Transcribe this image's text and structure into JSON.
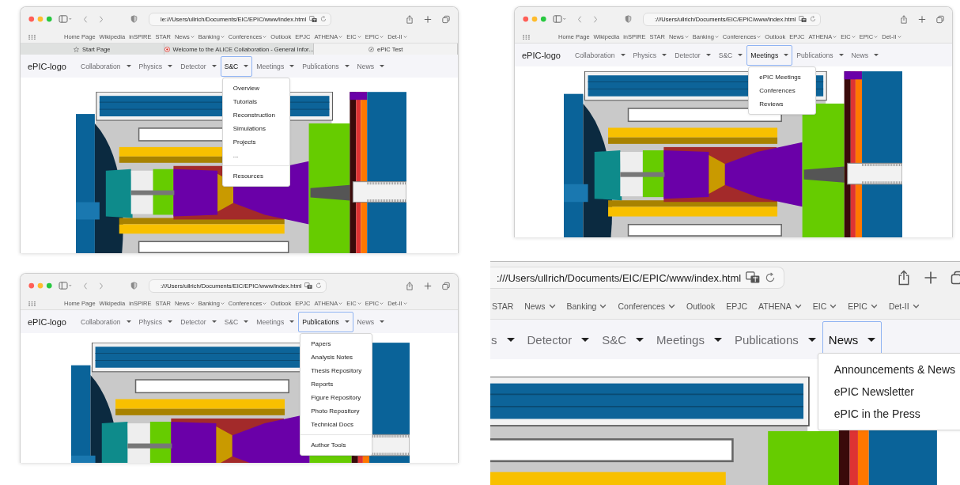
{
  "panels": [
    {
      "kind": "window",
      "address": "le:///Users/ullrich/Documents/EIC/EPIC/www/index.html",
      "bookmarks": [
        {
          "label": "Home Page",
          "menu": false
        },
        {
          "label": "Wikipedia",
          "menu": false
        },
        {
          "label": "inSPIRE",
          "menu": false
        },
        {
          "label": "STAR",
          "menu": false
        },
        {
          "label": "News",
          "menu": true
        },
        {
          "label": "Banking",
          "menu": true
        },
        {
          "label": "Conferences",
          "menu": true
        },
        {
          "label": "Outlook",
          "menu": false
        },
        {
          "label": "EPJC",
          "menu": false
        },
        {
          "label": "ATHENA",
          "menu": true
        },
        {
          "label": "EIC",
          "menu": true
        },
        {
          "label": "EPIC",
          "menu": true
        },
        {
          "label": "Det-II",
          "menu": true
        }
      ],
      "tabs": [
        {
          "label": "Start Page",
          "kind": "star",
          "selected": false
        },
        {
          "label": "Welcome to the ALICE Collaboration - General Infor...",
          "kind": "logo",
          "selected": false
        },
        {
          "label": "ePIC Test",
          "kind": "compass",
          "selected": true
        }
      ],
      "brand": "ePIC-logo",
      "nav": [
        {
          "label": "Collaboration",
          "selected": false
        },
        {
          "label": "Physics",
          "selected": false
        },
        {
          "label": "Detector",
          "selected": false
        },
        {
          "label": "S&C",
          "selected": true,
          "menu": [
            {
              "label": "Overview",
              "divider_before": false
            },
            {
              "label": "Tutorials",
              "divider_before": false
            },
            {
              "label": "Reconstruction",
              "divider_before": false
            },
            {
              "label": "Simulations",
              "divider_before": false
            },
            {
              "label": "Projects",
              "divider_before": false
            },
            {
              "label": "...",
              "divider_before": false
            },
            {
              "label": "Resources",
              "divider_before": true
            }
          ]
        },
        {
          "label": "Meetings",
          "selected": false
        },
        {
          "label": "Publications",
          "selected": false
        },
        {
          "label": "News",
          "selected": false
        }
      ]
    },
    {
      "kind": "window",
      "address": ":///Users/ullrich/Documents/EIC/EPIC/www/index.html",
      "bookmarks": [
        {
          "label": "Home Page",
          "menu": false
        },
        {
          "label": "Wikipedia",
          "menu": false
        },
        {
          "label": "inSPIRE",
          "menu": false
        },
        {
          "label": "STAR",
          "menu": false
        },
        {
          "label": "News",
          "menu": true
        },
        {
          "label": "Banking",
          "menu": true
        },
        {
          "label": "Conferences",
          "menu": true
        },
        {
          "label": "Outlook",
          "menu": false
        },
        {
          "label": "EPJC",
          "menu": false
        },
        {
          "label": "ATHENA",
          "menu": true
        },
        {
          "label": "EIC",
          "menu": true
        },
        {
          "label": "EPIC",
          "menu": true
        },
        {
          "label": "Det-II",
          "menu": true
        }
      ],
      "brand": "ePIC-logo",
      "nav": [
        {
          "label": "Collaboration",
          "selected": false
        },
        {
          "label": "Physics",
          "selected": false
        },
        {
          "label": "Detector",
          "selected": false
        },
        {
          "label": "S&C",
          "selected": false
        },
        {
          "label": "Meetings",
          "selected": true,
          "menu": [
            {
              "label": "ePIC Meetings",
              "divider_before": false
            },
            {
              "label": "Conferences",
              "divider_before": false
            },
            {
              "label": "Reviews",
              "divider_before": false
            }
          ]
        },
        {
          "label": "Publications",
          "selected": false
        },
        {
          "label": "News",
          "selected": false
        }
      ]
    },
    {
      "kind": "window",
      "address": ":///Users/ullrich/Documents/EIC/EPIC/www/index.html",
      "bookmarks": [
        {
          "label": "Home Page",
          "menu": false
        },
        {
          "label": "Wikipedia",
          "menu": false
        },
        {
          "label": "inSPIRE",
          "menu": false
        },
        {
          "label": "STAR",
          "menu": false
        },
        {
          "label": "News",
          "menu": true
        },
        {
          "label": "Banking",
          "menu": true
        },
        {
          "label": "Conferences",
          "menu": true
        },
        {
          "label": "Outlook",
          "menu": false
        },
        {
          "label": "EPJC",
          "menu": false
        },
        {
          "label": "ATHENA",
          "menu": true
        },
        {
          "label": "EIC",
          "menu": true
        },
        {
          "label": "EPIC",
          "menu": true
        },
        {
          "label": "Det-II",
          "menu": true
        }
      ],
      "brand": "ePIC-logo",
      "nav": [
        {
          "label": "Collaboration",
          "selected": false
        },
        {
          "label": "Physics",
          "selected": false
        },
        {
          "label": "Detector",
          "selected": false
        },
        {
          "label": "S&C",
          "selected": false
        },
        {
          "label": "Meetings",
          "selected": false
        },
        {
          "label": "Publications",
          "selected": true,
          "menu": [
            {
              "label": "Papers",
              "divider_before": false
            },
            {
              "label": "Analysis Notes",
              "divider_before": false
            },
            {
              "label": "Thesis Repository",
              "divider_before": false
            },
            {
              "label": "Reports",
              "divider_before": false
            },
            {
              "label": "Figure Repository",
              "divider_before": false
            },
            {
              "label": "Photo Repository",
              "divider_before": false
            },
            {
              "label": "Technical Docs",
              "divider_before": false
            },
            {
              "label": "Author Tools",
              "divider_before": true
            }
          ]
        },
        {
          "label": "News",
          "selected": false
        }
      ]
    },
    {
      "kind": "zoomed",
      "address": ":///Users/ullrich/Documents/EIC/EPIC/www/index.html",
      "bookmarks": [
        {
          "label": "STAR",
          "menu": false
        },
        {
          "label": "News",
          "menu": true
        },
        {
          "label": "Banking",
          "menu": true
        },
        {
          "label": "Conferences",
          "menu": true
        },
        {
          "label": "Outlook",
          "menu": false
        },
        {
          "label": "EPJC",
          "menu": false
        },
        {
          "label": "ATHENA",
          "menu": true
        },
        {
          "label": "EIC",
          "menu": true
        },
        {
          "label": "EPIC",
          "menu": true
        },
        {
          "label": "Det-II",
          "menu": true
        }
      ],
      "nav": [
        {
          "label": "s",
          "selected": false
        },
        {
          "label": "Detector",
          "selected": false
        },
        {
          "label": "S&C",
          "selected": false
        },
        {
          "label": "Meetings",
          "selected": false
        },
        {
          "label": "Publications",
          "selected": false
        },
        {
          "label": "News",
          "selected": true,
          "menu": [
            {
              "label": "Announcements & News",
              "divider_before": false
            },
            {
              "label": "ePIC Newsletter",
              "divider_before": false
            },
            {
              "label": "ePIC in the Press",
              "divider_before": false
            }
          ]
        }
      ]
    }
  ]
}
